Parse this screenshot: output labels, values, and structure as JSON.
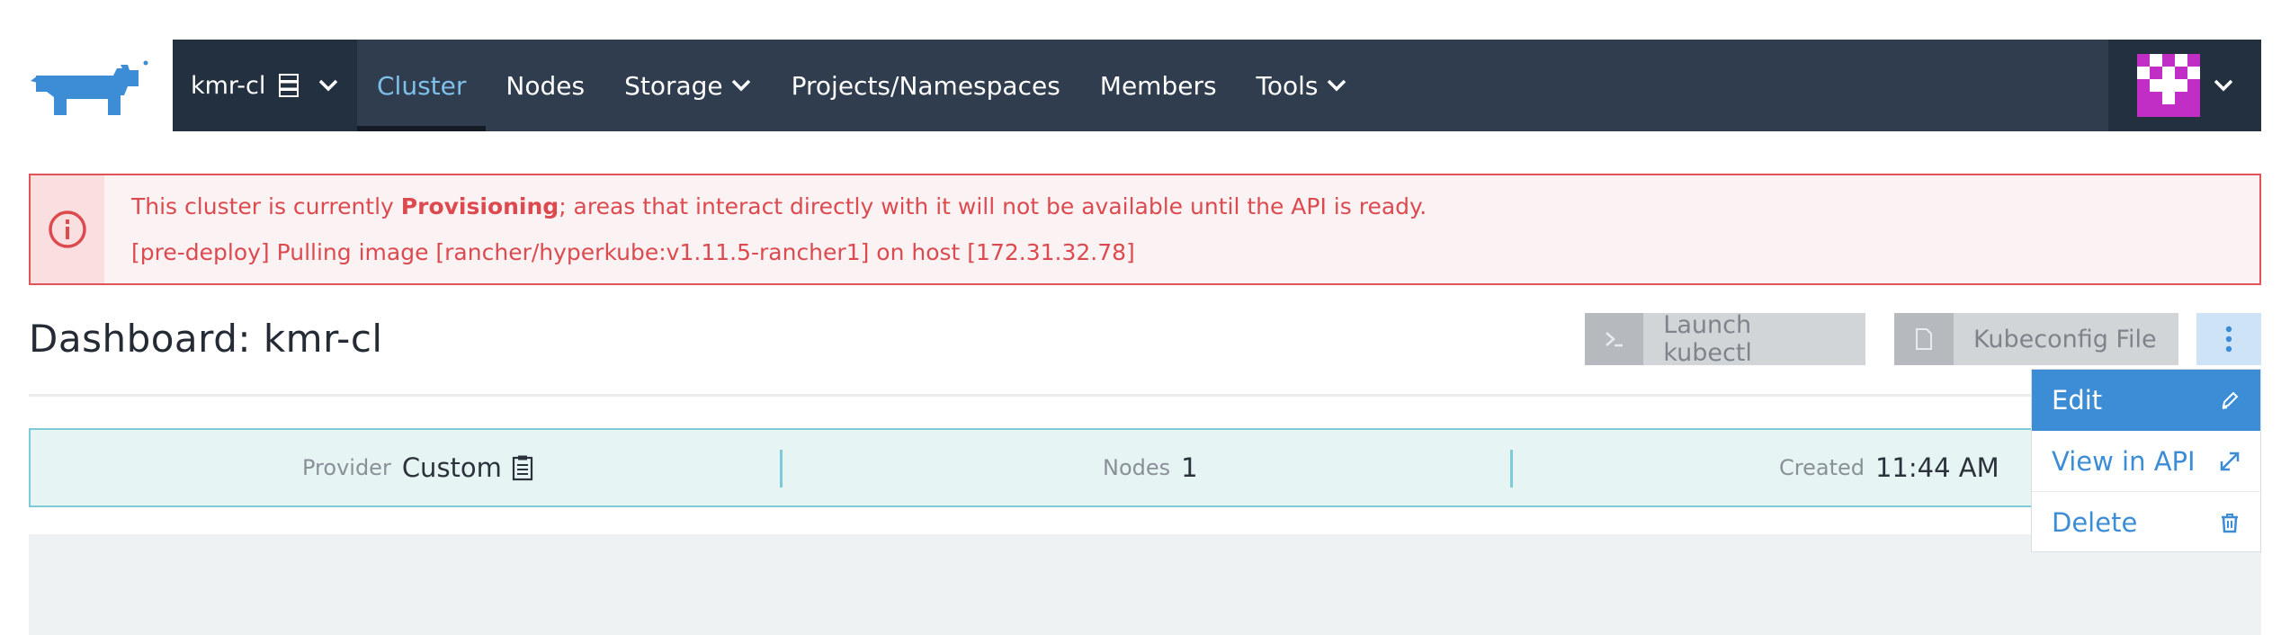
{
  "header": {
    "cluster_name": "kmr-cl",
    "nav_items": [
      {
        "label": "Cluster",
        "active": true,
        "dropdown": false
      },
      {
        "label": "Nodes",
        "active": false,
        "dropdown": false
      },
      {
        "label": "Storage",
        "active": false,
        "dropdown": true
      },
      {
        "label": "Projects/Namespaces",
        "active": false,
        "dropdown": false
      },
      {
        "label": "Members",
        "active": false,
        "dropdown": false
      },
      {
        "label": "Tools",
        "active": false,
        "dropdown": true
      }
    ]
  },
  "alert": {
    "line1_prefix": "This cluster is currently ",
    "line1_status": "Provisioning",
    "line1_suffix": "; areas that interact directly with it will not be available until the API is ready.",
    "line2": "[pre-deploy] Pulling image [rancher/hyperkube:v1.11.5-rancher1] on host [172.31.32.78]"
  },
  "page": {
    "title": "Dashboard: kmr-cl"
  },
  "actions": {
    "kubectl_label": "Launch kubectl",
    "kubeconfig_label": "Kubeconfig File"
  },
  "info": {
    "provider_key": "Provider",
    "provider_value": "Custom",
    "nodes_key": "Nodes",
    "nodes_value": "1",
    "created_key": "Created",
    "created_value": "11:44 AM"
  },
  "menu": {
    "items": [
      {
        "label": "Edit",
        "icon": "pencil-icon"
      },
      {
        "label": "View in API",
        "icon": "external-link-icon"
      },
      {
        "label": "Delete",
        "icon": "trash-icon"
      }
    ]
  },
  "colors": {
    "nav_bg": "#2f3d4f",
    "accent": "#3d8cd6",
    "alert": "#dc4a4f",
    "info_border": "#7ecad6"
  }
}
